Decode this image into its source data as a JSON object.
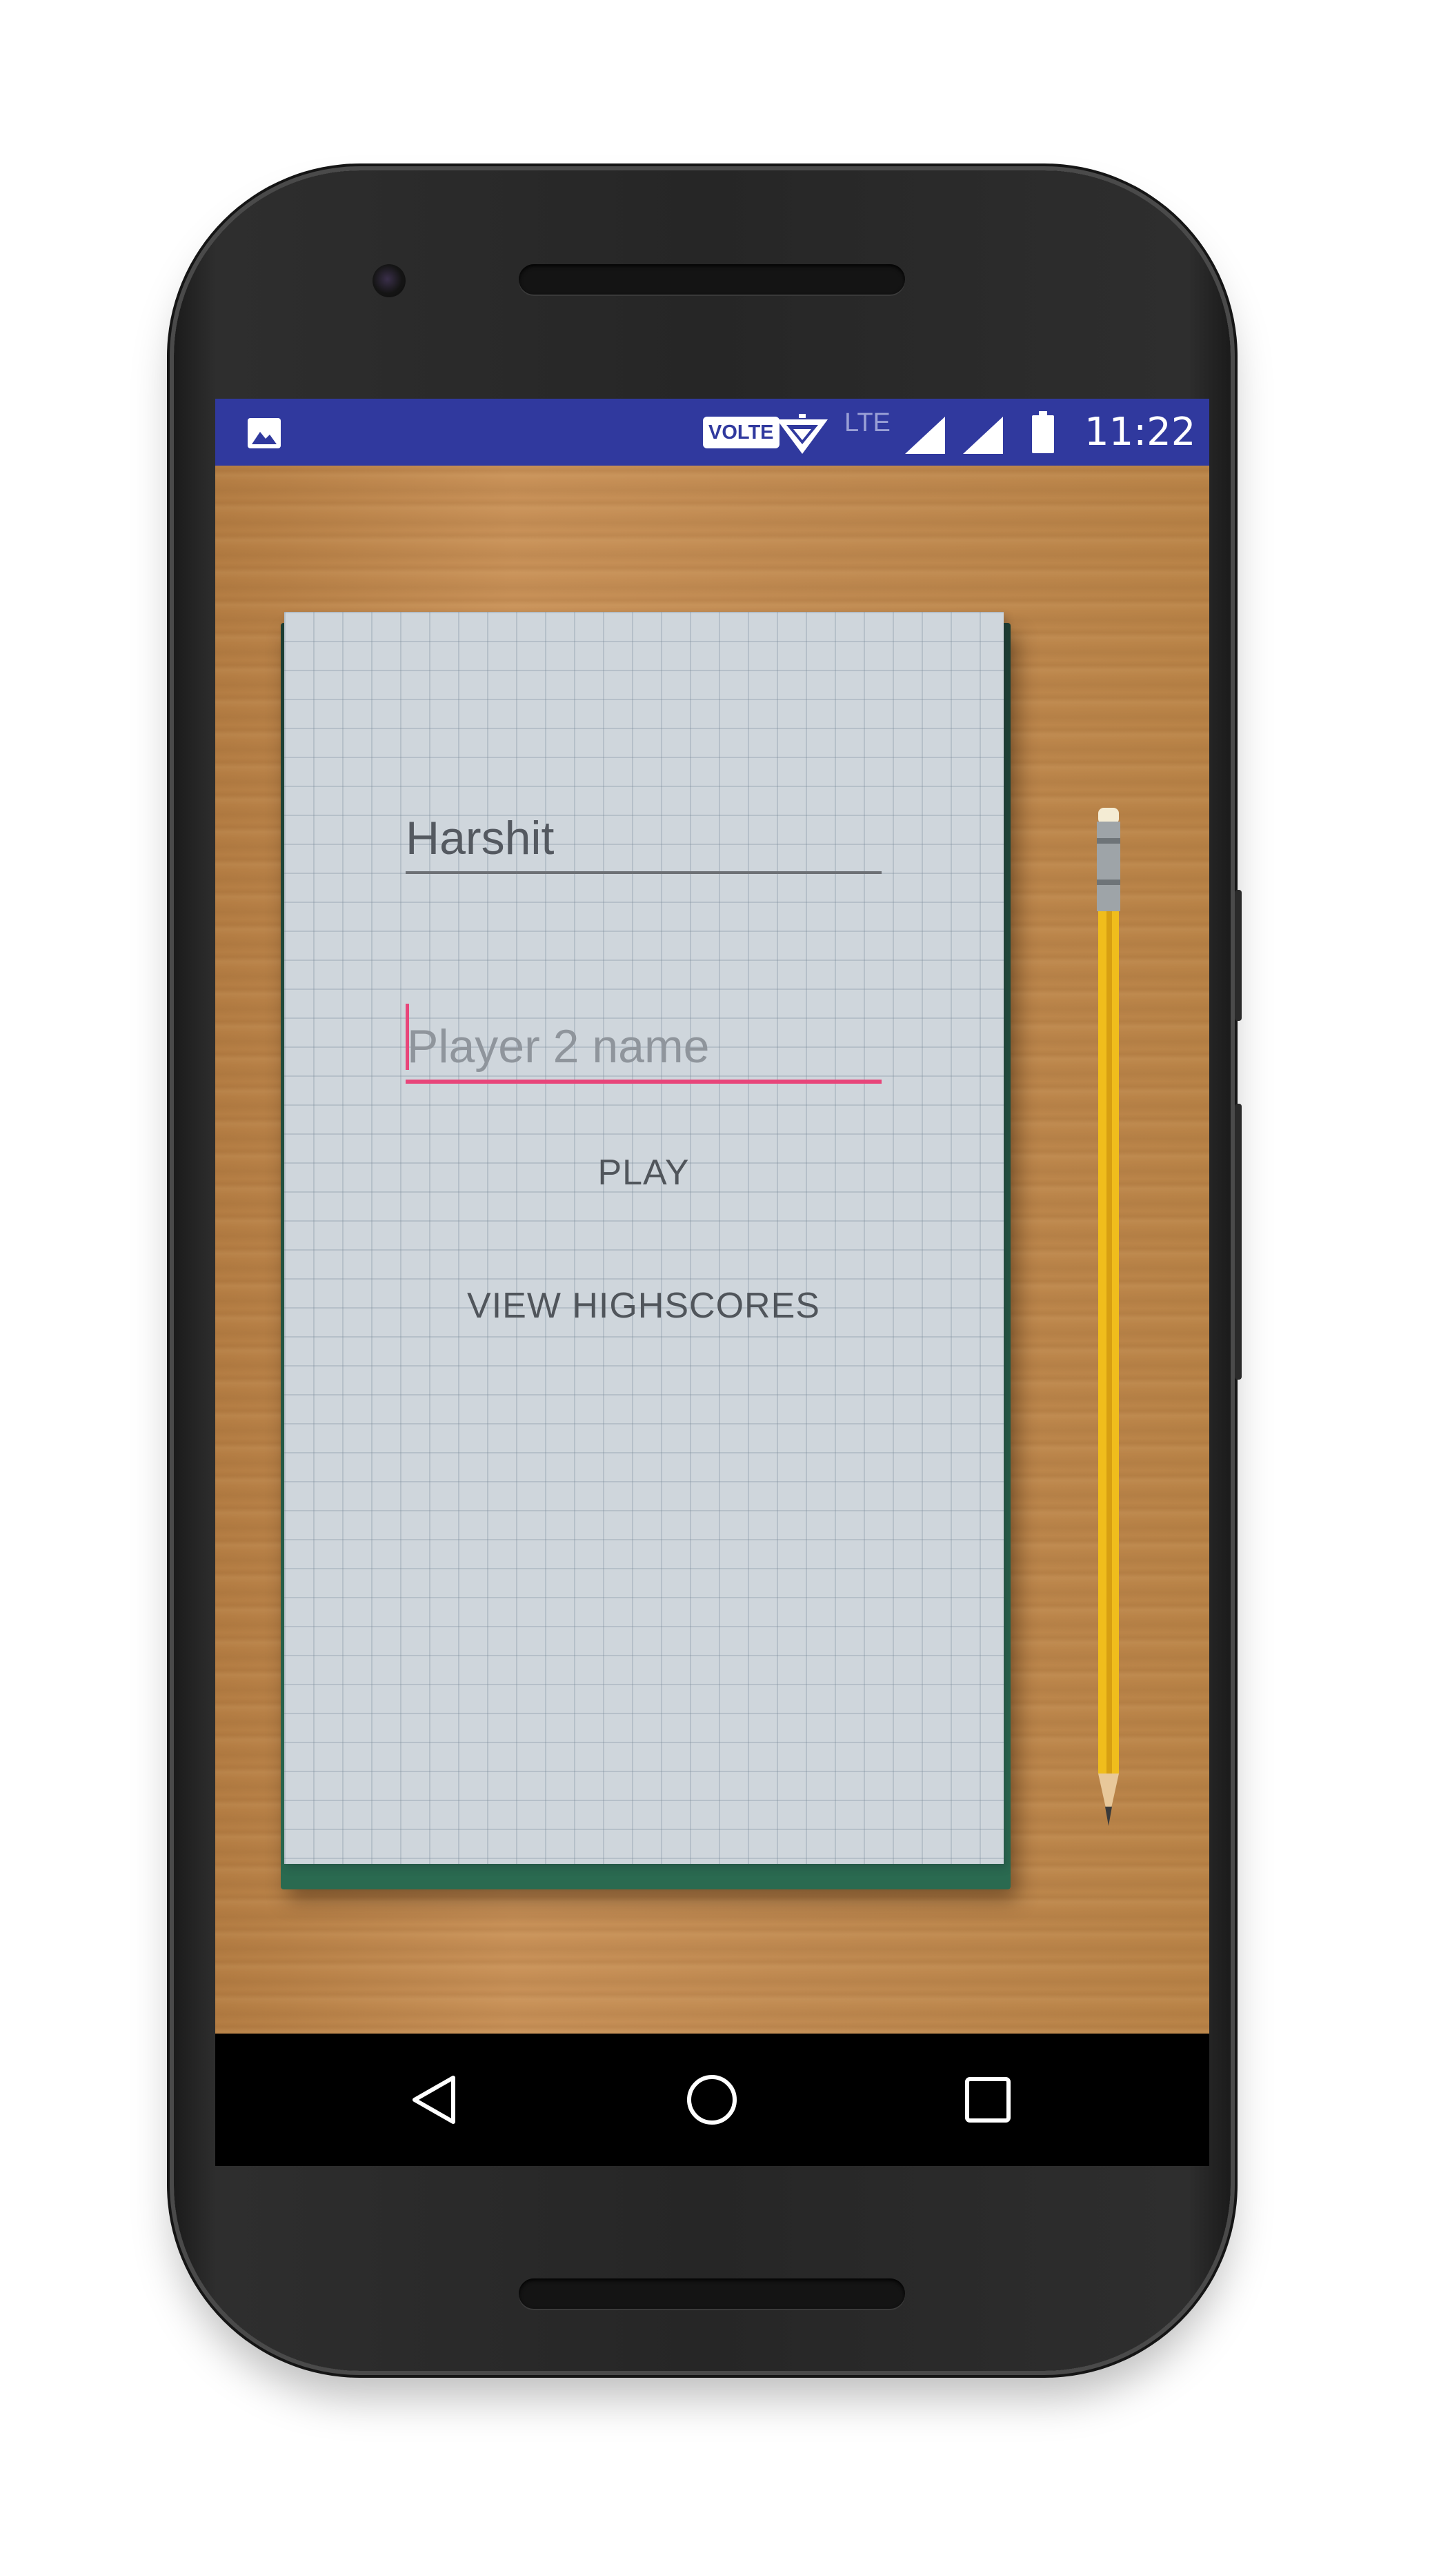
{
  "status_bar": {
    "volte_label": "VOLTE",
    "network_label": "LTE",
    "time": "11:22",
    "icons": [
      "gallery-icon",
      "wifi-icon",
      "signal-icon",
      "signal-icon",
      "battery-icon"
    ],
    "background_color": "#30399e"
  },
  "form": {
    "player1_value": "Harshit",
    "player2_placeholder": "Player 2 name",
    "play_label": "PLAY",
    "highscores_label": "VIEW HIGHSCORES",
    "accent_color": "#e8457a"
  },
  "nav_bar": {
    "icons": [
      "back-icon",
      "home-icon",
      "recents-icon"
    ]
  }
}
